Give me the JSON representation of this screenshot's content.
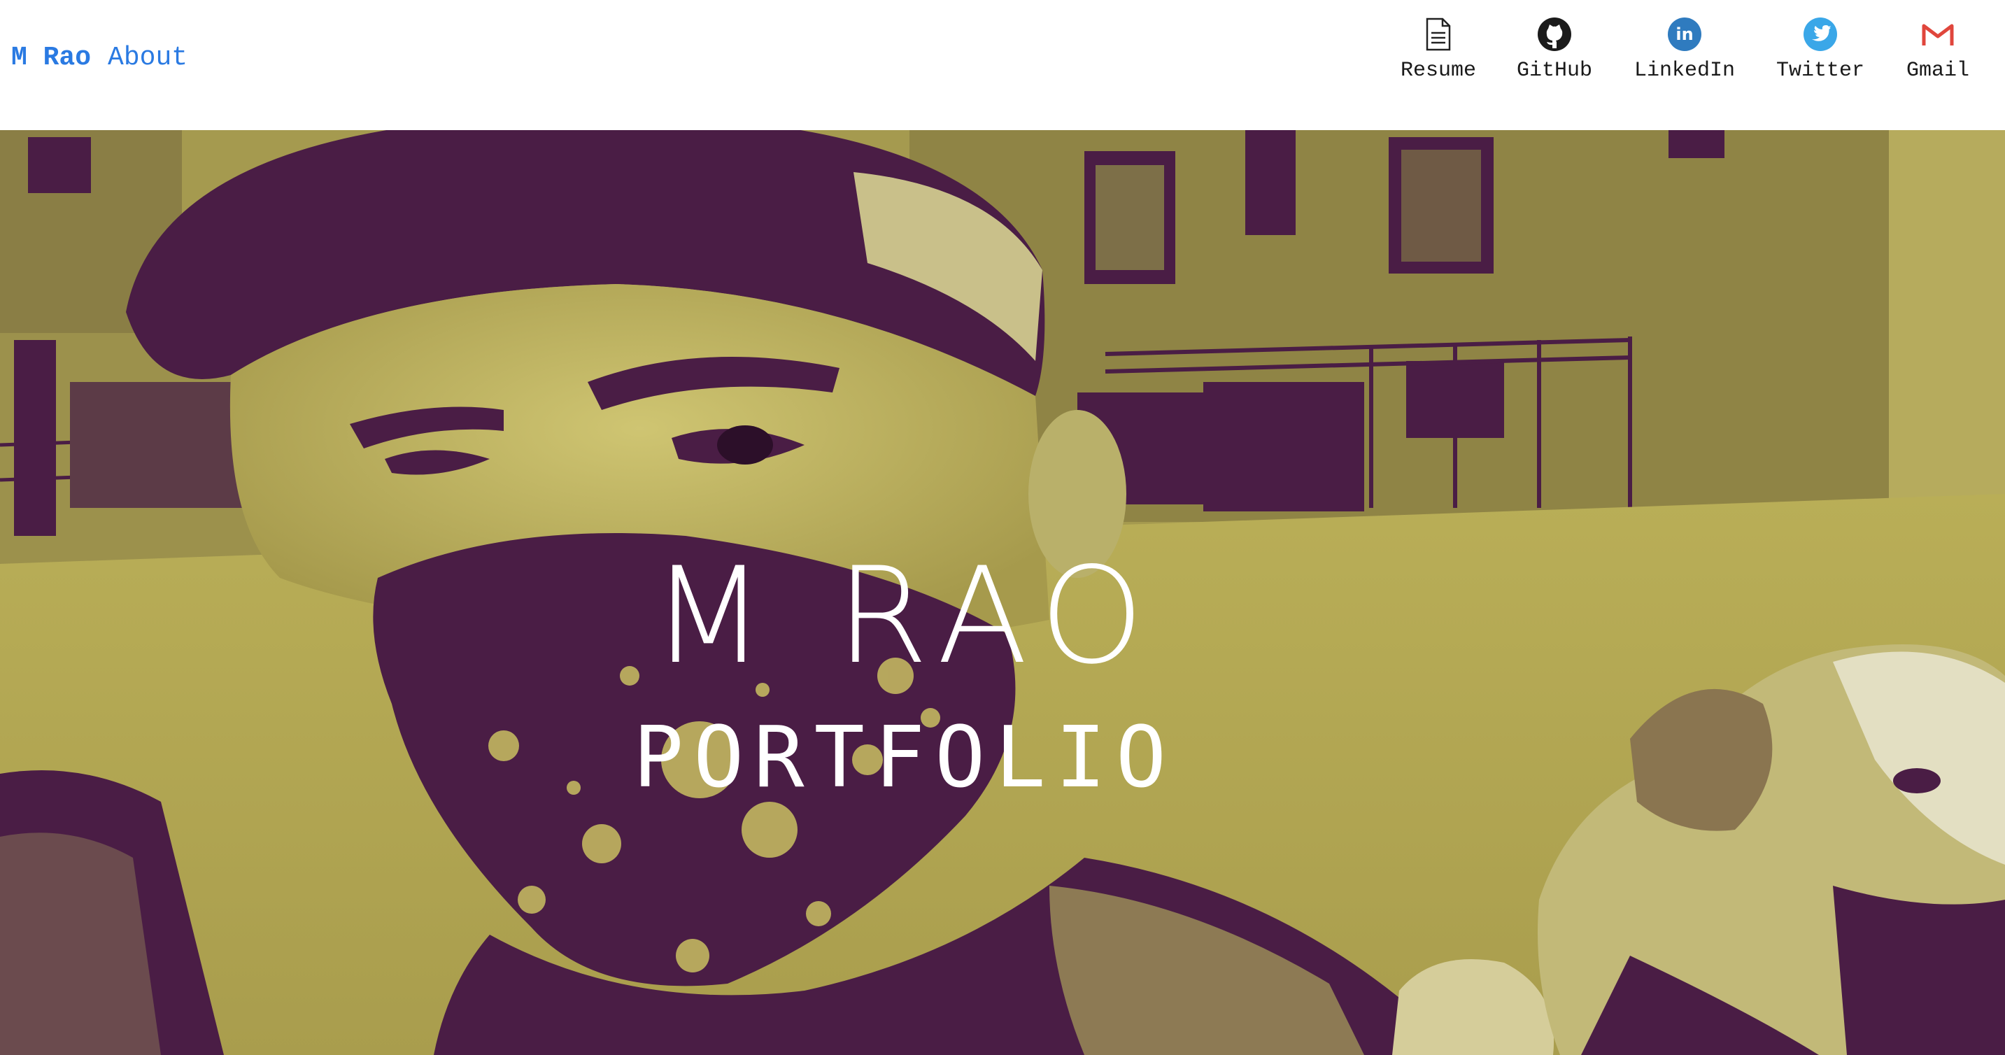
{
  "header": {
    "brand": "M Rao",
    "about_label": "About",
    "link_color": "#2a7ae2"
  },
  "social": [
    {
      "label": "Resume",
      "icon": "document-icon"
    },
    {
      "label": "GitHub",
      "icon": "github-icon"
    },
    {
      "label": "LinkedIn",
      "icon": "linkedin-icon",
      "color": "#2f7bbf"
    },
    {
      "label": "Twitter",
      "icon": "twitter-icon",
      "color": "#3aa7e8"
    },
    {
      "label": "Gmail",
      "icon": "gmail-icon",
      "color": "#e0463c"
    }
  ],
  "hero": {
    "title": "M RAO",
    "subtitle": "PORTFOLIO",
    "duotone_dark": "#4a1d45",
    "duotone_light": "#c9bf62"
  }
}
